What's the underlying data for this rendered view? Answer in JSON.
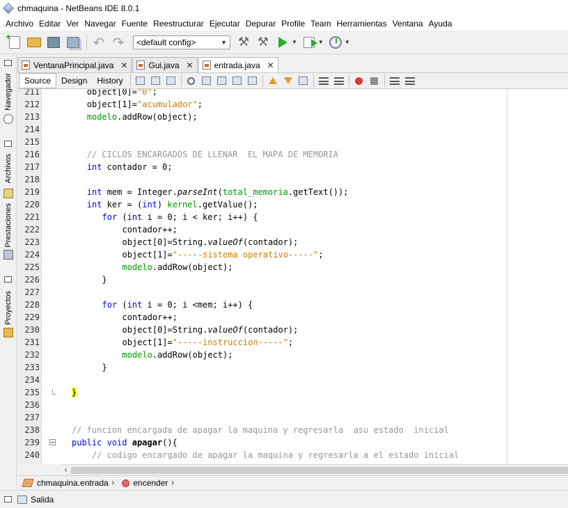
{
  "window": {
    "title": "chmaquina - NetBeans IDE 8.0.1"
  },
  "menu": [
    "Archivo",
    "Editar",
    "Ver",
    "Navegar",
    "Fuente",
    "Reestructurar",
    "Ejecutar",
    "Depurar",
    "Profile",
    "Team",
    "Herramientas",
    "Ventana",
    "Ayuda"
  ],
  "toolbar": {
    "config": "<default config>"
  },
  "sidebar": [
    "Navegador",
    "Archivos",
    "Prestaciones",
    "Proyectos"
  ],
  "tabs": [
    {
      "label": "VentanaPrincipal.java",
      "active": false
    },
    {
      "label": "Gui.java",
      "active": false
    },
    {
      "label": "entrada.java",
      "active": true
    }
  ],
  "editor_tabs": [
    "Source",
    "Design",
    "History"
  ],
  "breadcrumb": [
    "chmaquina.entrada",
    "encender"
  ],
  "output": {
    "label": "Salida"
  },
  "colors": {
    "keyword": "#0000e6",
    "string": "#ce7b00",
    "comment": "#969696",
    "field": "#009900",
    "highlight": "#ffff00"
  },
  "code": [
    {
      "n": "211",
      "html": "object[0]=<span class=\"str\">\"0\"</span>;",
      "indent": 8
    },
    {
      "n": "212",
      "html": "object[1]=<span class=\"str\">\"acumulador\"</span>;",
      "indent": 8
    },
    {
      "n": "213",
      "html": "<span class=\"fld\">modelo</span>.addRow(object);",
      "indent": 8
    },
    {
      "n": "214",
      "html": "",
      "indent": 8
    },
    {
      "n": "215",
      "html": "",
      "indent": 8
    },
    {
      "n": "216",
      "html": "<span class=\"cm\">// CICLOS ENCARGADOS DE LLENAR  EL MAPA DE MEMORIA</span>",
      "indent": 8
    },
    {
      "n": "217",
      "html": "<span class=\"kw\">int</span> contador = 0;",
      "indent": 8
    },
    {
      "n": "218",
      "html": "",
      "indent": 8
    },
    {
      "n": "219",
      "html": "<span class=\"kw\">int</span> mem = Integer.<span class=\"it\">parseInt</span>(<span class=\"fld\">total_memoria</span>.getText());",
      "indent": 8
    },
    {
      "n": "220",
      "html": "<span class=\"kw\">int</span> ker = (<span class=\"kw\">int</span>) <span class=\"fld\">kernel</span>.getValue();",
      "indent": 8
    },
    {
      "n": "221",
      "html": "<span class=\"kw\">for</span> (<span class=\"kw\">int</span> i = 0; i &lt; ker; i++) {",
      "indent": 11
    },
    {
      "n": "222",
      "html": "contador++;",
      "indent": 15
    },
    {
      "n": "223",
      "html": "object[0]=String.<span class=\"it\">valueOf</span>(contador);",
      "indent": 15
    },
    {
      "n": "224",
      "html": "object[1]=<span class=\"str\">\"-----sistema operativo-----\"</span>;",
      "indent": 15
    },
    {
      "n": "225",
      "html": "<span class=\"fld\">modelo</span>.addRow(object);",
      "indent": 15
    },
    {
      "n": "226",
      "html": "}",
      "indent": 11
    },
    {
      "n": "227",
      "html": "",
      "indent": 8
    },
    {
      "n": "228",
      "html": "<span class=\"kw\">for</span> (<span class=\"kw\">int</span> i = 0; i &lt;mem; i++) {",
      "indent": 11
    },
    {
      "n": "229",
      "html": "contador++;",
      "indent": 15
    },
    {
      "n": "230",
      "html": "object[0]=String.<span class=\"it\">valueOf</span>(contador);",
      "indent": 15
    },
    {
      "n": "231",
      "html": "object[1]=<span class=\"str\">\"-----instruccion-----\"</span>;",
      "indent": 15
    },
    {
      "n": "232",
      "html": "<span class=\"fld\">modelo</span>.addRow(object);",
      "indent": 15
    },
    {
      "n": "233",
      "html": "}",
      "indent": 11
    },
    {
      "n": "234",
      "html": "",
      "indent": 8
    },
    {
      "n": "235",
      "html": "<span class=\"hl\">}</span>",
      "indent": 5
    },
    {
      "n": "236",
      "html": "",
      "indent": 5
    },
    {
      "n": "237",
      "html": "",
      "indent": 5
    },
    {
      "n": "238",
      "html": "<span class=\"cm\">// funcion encargada de apagar la maquina y regresarla  asu estado  inicial</span>",
      "indent": 5
    },
    {
      "n": "239",
      "html": "<span class=\"kw\">public</span> <span class=\"kw\">void</span> <span class=\"bold\">apagar</span>(){",
      "indent": 5
    },
    {
      "n": "240",
      "html": "<span class=\"cm\">// codigo encargado de apagar la maquina y regresarla a el estado inicial</span>",
      "indent": 9
    }
  ]
}
